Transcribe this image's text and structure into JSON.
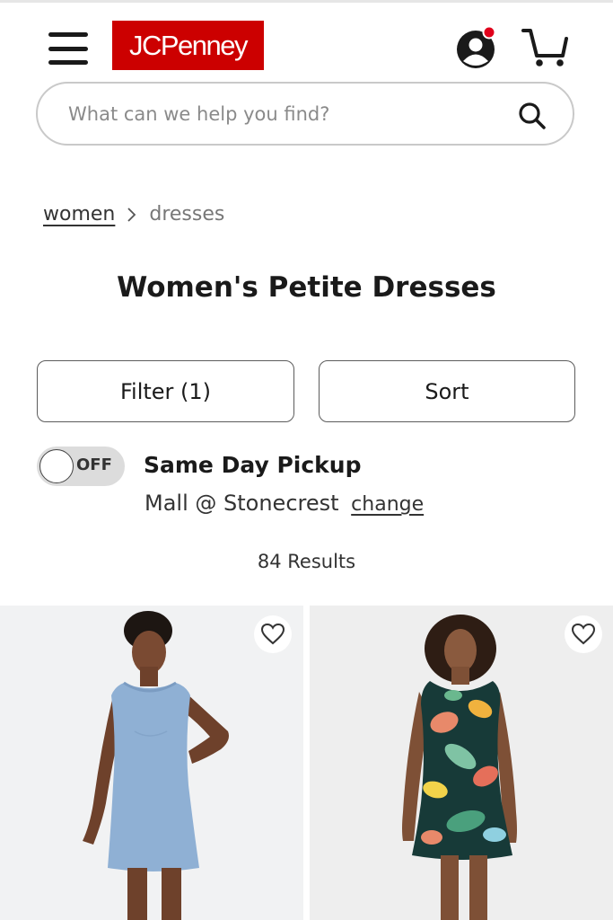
{
  "header": {
    "logo_text": "JCPenney",
    "brand_color": "#cc0000",
    "notification_color": "#e0001b"
  },
  "search": {
    "placeholder": "What can we help you find?"
  },
  "breadcrumb": {
    "parent": "women",
    "current": "dresses"
  },
  "page": {
    "title": "Women's Petite Dresses"
  },
  "controls": {
    "filter_label": "Filter (1)",
    "sort_label": "Sort"
  },
  "pickup": {
    "toggle_state": "OFF",
    "title": "Same Day Pickup",
    "store": "Mall @ Stonecrest",
    "change_label": "change"
  },
  "results": {
    "count_label": "84 Results"
  },
  "products": [
    {
      "image": "blue denim sleeveless shift dress",
      "favorite_icon": "heart-outline-icon"
    },
    {
      "image": "tropical floral print sleeveless dress",
      "favorite_icon": "heart-outline-icon"
    }
  ],
  "icons": {
    "menu": "hamburger-menu-icon",
    "account": "account-icon",
    "cart": "cart-icon",
    "search": "search-icon",
    "breadcrumb_separator": "chevron-right-icon"
  }
}
